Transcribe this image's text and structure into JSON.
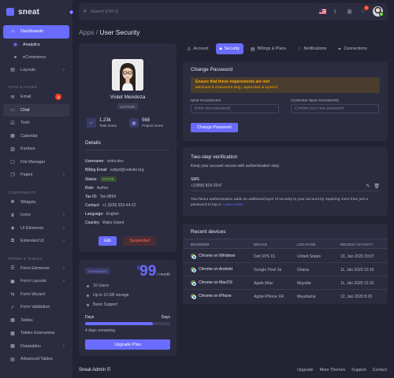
{
  "brand": {
    "name": "sneat"
  },
  "search": {
    "placeholder": "Search [Ctrl+/]"
  },
  "topbar": {
    "notification_count": "4"
  },
  "sidebar": {
    "dashboards": "Dashboards",
    "analytics": "Analytics",
    "ecommerce": "eCommerce",
    "layouts": "Layouts",
    "section_apps": "APPS & PAGES",
    "email": "Email",
    "email_count": "4",
    "chat": "Chat",
    "todo": "Todo",
    "calendar": "Calendar",
    "kanban": "Kanban",
    "file_manager": "File Manager",
    "pages": "Pages",
    "section_components": "COMPONENTS",
    "widgets": "Widgets",
    "icons": "Icons",
    "ui_elements": "UI Elements",
    "extended_ui": "Extended UI",
    "section_forms": "FORMS & TABLES",
    "form_elements": "Form Elements",
    "form_layouts": "Form Layouts",
    "form_wizard": "Form Wizard",
    "form_validation": "Form Validation",
    "tables": "Tables",
    "tables_extensions": "Tables Extensions",
    "datatables": "Datatables",
    "advanced_tables": "Advanced Tables"
  },
  "breadcrumb": {
    "parent": "Apps / ",
    "current": "User Security"
  },
  "profile": {
    "name": "Violet Mendoza",
    "role": "AUTHOR",
    "tasks_done": "1.23k",
    "tasks_label": "Task Done",
    "projects_done": "568",
    "projects_label": "Project Done",
    "details_title": "Details",
    "username_label": "Username:",
    "username": "violet.dev",
    "email_label": "Billing Email:",
    "email": "vafgot@vultukir.org",
    "status_label": "Status:",
    "status": "ACTIVE",
    "role_label": "Role:",
    "role_value": "Author",
    "tax_label": "Tax ID:",
    "tax": "Tax-8894",
    "contact_label": "Contact:",
    "contact": "+1 (609) 933-44-22",
    "language_label": "Language:",
    "language": "English",
    "country_label": "Country:",
    "country": "Wake Island",
    "edit": "Edit",
    "suspended": "Suspended"
  },
  "plan": {
    "badge": "STANDARD",
    "currency": "$",
    "price": "99",
    "period": "/ month",
    "features": [
      "10 Users",
      "Up to 10 GB storage",
      "Basic Support"
    ],
    "days_label": "Days",
    "days_label_right": "Days",
    "progress_fraction": 0.8,
    "remaining": "4 days remaining",
    "upgrade": "Upgrade Plan"
  },
  "tabs": {
    "account": "Account",
    "security": "Security",
    "billing": "Billings & Plans",
    "notifications": "Notifications",
    "connections": "Connections"
  },
  "change_password": {
    "title": "Change Password",
    "alert_title": "Ensure that these requirements are met",
    "alert_text": "Minimum 8 characters long, uppercase & symbol",
    "new_label": "NEW PASSWORD",
    "new_placeholder": "Enter new password",
    "confirm_label": "CONFIRM NEW PASSWORD",
    "confirm_placeholder": "Confirm your new password",
    "button": "Change Password"
  },
  "two_step": {
    "title": "Two-step verification",
    "subtitle": "Keep your account secure with authentication step.",
    "sms_label": "SMS",
    "phone": "+1(968) 819-2547",
    "desc": "Two-factor authentication adds an additional layer of security to your account by requiring more than just a password to log in.",
    "learn_more": "Learn more."
  },
  "devices": {
    "title": "Recent devices",
    "headers": [
      "BROWSER",
      "DEVICE",
      "LOCATION",
      "RECENT ACTIVITY"
    ],
    "rows": [
      [
        "Chrome on Windows",
        "Dell XPS 15",
        "United States",
        "10, Jan 2020 20:07"
      ],
      [
        "Chrome on Android",
        "Google Pixel 3a",
        "Ghana",
        "11, Jan 2020 10:16"
      ],
      [
        "Chrome on MacOS",
        "Apple iMac",
        "Mayotte",
        "11, Jan 2020 12:10"
      ],
      [
        "Chrome on iPhone",
        "Apple iPhone XR",
        "Mauritania",
        "12, Jan 2020 8:29"
      ]
    ]
  },
  "footer": {
    "brand": "Sneat Admin ©",
    "links": [
      "Upgrade",
      "More Themes",
      "Support",
      "Contact"
    ]
  },
  "colors": {
    "primary": "#696cff",
    "bg": "#232333",
    "card": "#2b2c40",
    "success": "#71dd37",
    "danger": "#ff3e1d",
    "warning": "#ffab00"
  }
}
